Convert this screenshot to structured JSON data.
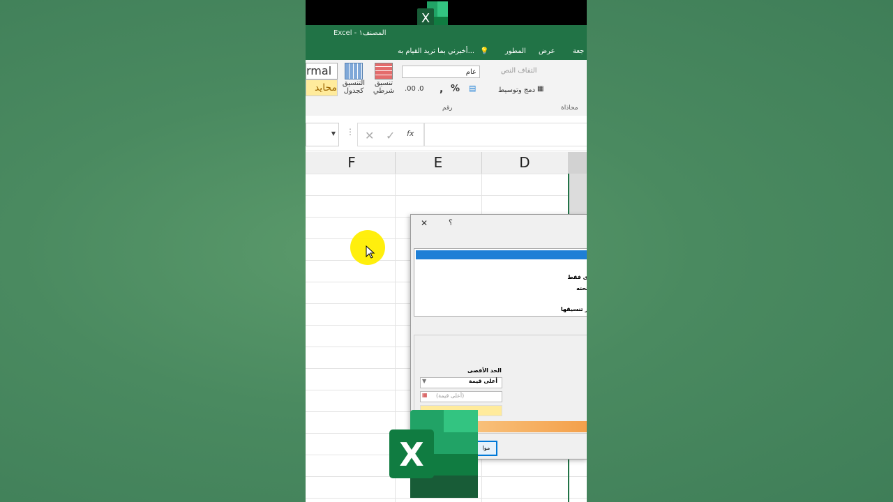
{
  "window": {
    "title": "Excel - المصنف١"
  },
  "menu": {
    "items": [
      "جعة",
      "عرض",
      "المطور"
    ],
    "tell_me": "أخبرني بما تريد القيام به..."
  },
  "ribbon": {
    "style_normal": "rmal",
    "style_neutral": "محايد",
    "format_table_1": "التنسيق",
    "format_table_2": "كجدول",
    "cond_format_1": "تنسيق",
    "cond_format_2": "شرطي",
    "number_format": "عام",
    "number_group": "رقم",
    "wrap_text": "التفاف النص",
    "merge_center": "دمج وتوسيط",
    "alignment_group": "محاذاة",
    "percent": "%",
    "comma": ","
  },
  "formula": {
    "fx": "fx",
    "cancel": "✕",
    "enter": "✓",
    "dots": "⋮"
  },
  "columns": [
    "F",
    "E",
    "D"
  ],
  "dialog": {
    "help": "؟",
    "close": "✕",
    "rule_line1": "ى فقط",
    "rule_line2": "تحته",
    "rule_line3": "ر تنسيقها",
    "max_label": "الحد الأقصى",
    "max_type": "أعلى قيمة",
    "max_value_placeholder": "(أعلى قيمة)",
    "ok": "موا"
  },
  "colors": {
    "excel_green": "#217346",
    "selection_blue": "#1e7fd6",
    "highlight": "#ffee00"
  }
}
